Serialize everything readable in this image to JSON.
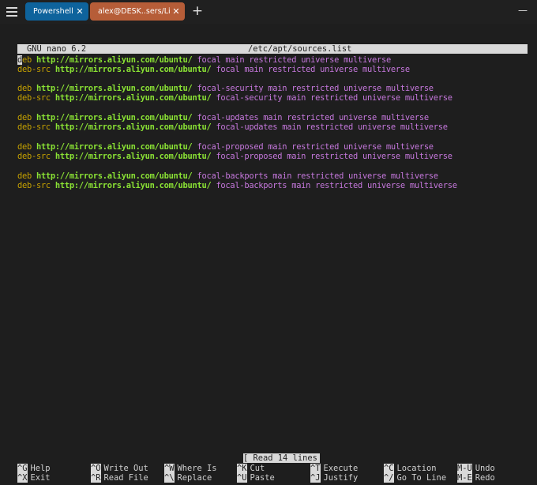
{
  "tabs": [
    {
      "label": "Powershell",
      "close": "✕"
    },
    {
      "label": "alex@DESK..sers/Lian",
      "close": "✕"
    }
  ],
  "new_tab": "+",
  "window": {
    "minimize": "—"
  },
  "nano": {
    "version": "GNU nano 6.2",
    "filename": "/etc/apt/sources.list",
    "status": "[ Read 14 lines ]"
  },
  "lines": [
    {
      "type": "deb",
      "url": "http://mirrors.aliyun.com/ubuntu/",
      "suite": "focal",
      "components": "main restricted universe multiverse"
    },
    {
      "type": "deb-src",
      "url": "http://mirrors.aliyun.com/ubuntu/",
      "suite": "focal",
      "components": "main restricted universe multiverse"
    },
    {
      "type": "deb",
      "url": "http://mirrors.aliyun.com/ubuntu/",
      "suite": "focal-security",
      "components": "main restricted universe multiverse"
    },
    {
      "type": "deb-src",
      "url": "http://mirrors.aliyun.com/ubuntu/",
      "suite": "focal-security",
      "components": "main restricted universe multiverse"
    },
    {
      "type": "deb",
      "url": "http://mirrors.aliyun.com/ubuntu/",
      "suite": "focal-updates",
      "components": "main restricted universe multiverse"
    },
    {
      "type": "deb-src",
      "url": "http://mirrors.aliyun.com/ubuntu/",
      "suite": "focal-updates",
      "components": "main restricted universe multiverse"
    },
    {
      "type": "deb",
      "url": "http://mirrors.aliyun.com/ubuntu/",
      "suite": "focal-proposed",
      "components": "main restricted universe multiverse"
    },
    {
      "type": "deb-src",
      "url": "http://mirrors.aliyun.com/ubuntu/",
      "suite": "focal-proposed",
      "components": "main restricted universe multiverse"
    },
    {
      "type": "deb",
      "url": "http://mirrors.aliyun.com/ubuntu/",
      "suite": "focal-backports",
      "components": "main restricted universe multiverse"
    },
    {
      "type": "deb-src",
      "url": "http://mirrors.aliyun.com/ubuntu/",
      "suite": "focal-backports",
      "components": "main restricted universe multiverse"
    }
  ],
  "shortcuts": [
    {
      "key": "^G",
      "label": "Help"
    },
    {
      "key": "^X",
      "label": "Exit"
    },
    {
      "key": "^O",
      "label": "Write Out"
    },
    {
      "key": "^R",
      "label": "Read File"
    },
    {
      "key": "^W",
      "label": "Where Is"
    },
    {
      "key": "^\\",
      "label": "Replace"
    },
    {
      "key": "^K",
      "label": "Cut"
    },
    {
      "key": "^U",
      "label": "Paste"
    },
    {
      "key": "^T",
      "label": "Execute"
    },
    {
      "key": "^J",
      "label": "Justify"
    },
    {
      "key": "^C",
      "label": "Location"
    },
    {
      "key": "^/",
      "label": "Go To Line"
    },
    {
      "key": "M-U",
      "label": "Undo"
    },
    {
      "key": "M-E",
      "label": "Redo"
    }
  ]
}
